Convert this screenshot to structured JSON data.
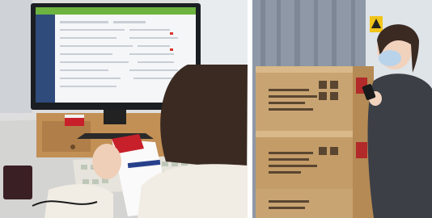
{
  "left_photo": {
    "caption": "",
    "colors": {
      "wall": "#dcdcdc",
      "desk": "#cfcfcf",
      "screen_header": "#6db33f",
      "box_red": "#c8202b",
      "hair": "#3a2a22",
      "sweater": "#f1ece4"
    }
  },
  "right_photo": {
    "caption": "",
    "colors": {
      "curtain": "#8e98a6",
      "carton": "#c9a473",
      "tape": "#d9b88a",
      "jacket": "#3c3f46",
      "mask": "#b9d3ea"
    }
  }
}
